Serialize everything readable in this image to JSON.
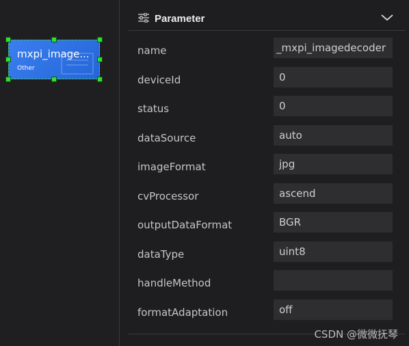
{
  "node": {
    "title": "mxpi_image...",
    "subtitle": "Other"
  },
  "panel": {
    "title": "Parameter",
    "icon": "sliders-icon",
    "collapse_icon": "chevron-down-icon"
  },
  "params": [
    {
      "label": "name",
      "value": "_mxpi_imagedecoder"
    },
    {
      "label": "deviceId",
      "value": "0"
    },
    {
      "label": "status",
      "value": "0"
    },
    {
      "label": "dataSource",
      "value": "auto"
    },
    {
      "label": "imageFormat",
      "value": "jpg"
    },
    {
      "label": "cvProcessor",
      "value": "ascend"
    },
    {
      "label": "outputDataFormat",
      "value": "BGR"
    },
    {
      "label": "dataType",
      "value": "uint8"
    },
    {
      "label": "handleMethod",
      "value": ""
    },
    {
      "label": "formatAdaptation",
      "value": "off"
    }
  ],
  "watermark": "CSDN @微微抚琴",
  "colors": {
    "background": "#1e1e20",
    "node_fill": "#2f74e8",
    "selection_handle": "#33dd33",
    "input_bg": "#2e2e30"
  }
}
